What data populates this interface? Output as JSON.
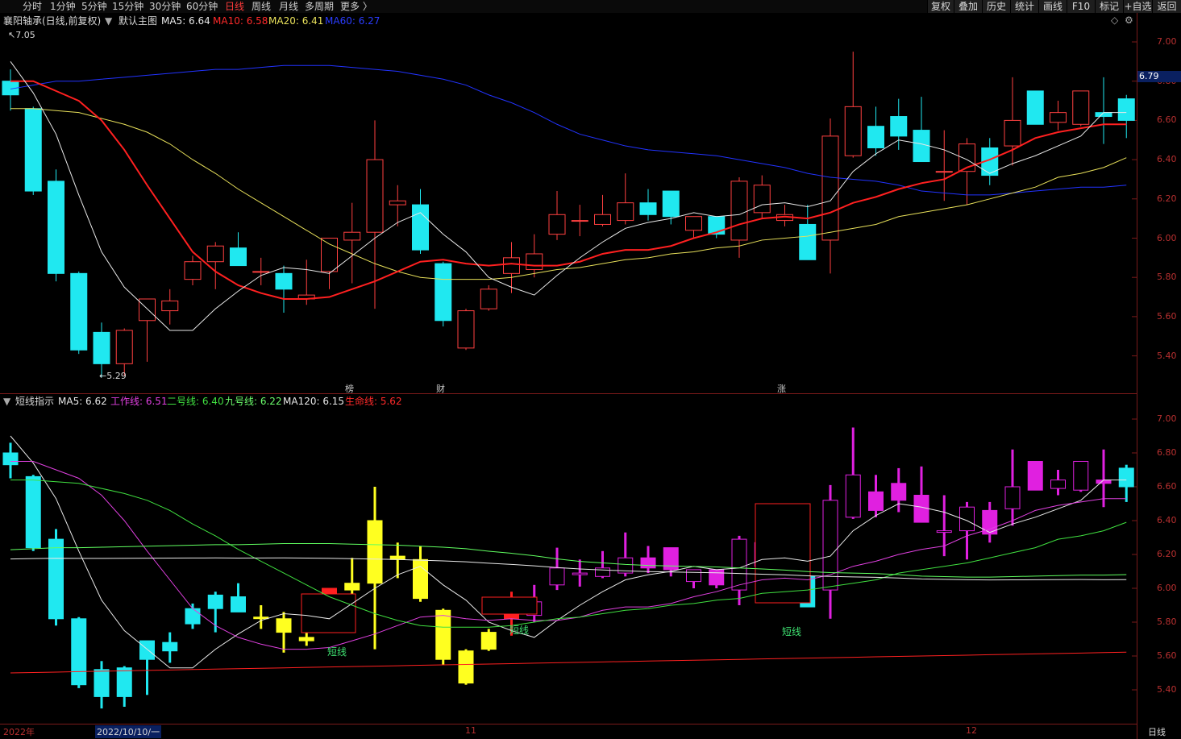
{
  "top_tabs": [
    {
      "label": "分时"
    },
    {
      "label": "1分钟"
    },
    {
      "label": "5分钟"
    },
    {
      "label": "15分钟"
    },
    {
      "label": "30分钟"
    },
    {
      "label": "60分钟"
    },
    {
      "label": "日线"
    },
    {
      "label": "周线"
    },
    {
      "label": "月线"
    },
    {
      "label": "多周期"
    },
    {
      "label": "更多 〉"
    }
  ],
  "active_tab": "日线",
  "right_tools": [
    {
      "label": "复权"
    },
    {
      "label": "叠加"
    },
    {
      "label": "历史"
    },
    {
      "label": "统计"
    },
    {
      "label": "画线"
    },
    {
      "label": "F10"
    },
    {
      "label": "标记"
    },
    {
      "label": "+自选"
    },
    {
      "label": "返回"
    }
  ],
  "main": {
    "title": "襄阳轴承(日线,前复权)",
    "template": "默认主图",
    "ma": [
      {
        "label": "MA5: 6.64",
        "color": "#e8e8e8"
      },
      {
        "label": "MA10: 6.58",
        "color": "#ff2a2a"
      },
      {
        "label": "MA20: 6.41",
        "color": "#e8e05a"
      },
      {
        "label": "MA60: 6.27",
        "color": "#2a3cff"
      }
    ],
    "y_ticks": [
      "7.00",
      "6.80",
      "6.60",
      "6.40",
      "6.20",
      "6.00",
      "5.80",
      "5.60",
      "5.40"
    ],
    "current_price": "6.79",
    "high_label": "7.05",
    "low_label": "5.29",
    "markers": [
      {
        "text": "榜",
        "color": "#ff9e40"
      },
      {
        "text": "财",
        "color": "#7ab8ff"
      },
      {
        "text": "涨",
        "color": "#ff6060"
      }
    ]
  },
  "sub": {
    "title": "短线指示",
    "lines": [
      {
        "label": "MA5: 6.62",
        "color": "#e8e8e8"
      },
      {
        "label": "工作线: 6.51",
        "color": "#e040e0"
      },
      {
        "label": "二号线: 6.40",
        "color": "#40e040"
      },
      {
        "label": "九号线: 6.22",
        "color": "#6cff6c"
      },
      {
        "label": "MA120: 6.15",
        "color": "#e8e8e8"
      },
      {
        "label": "生命线: 5.62",
        "color": "#ff2a2a"
      }
    ],
    "y_ticks": [
      "7.00",
      "6.80",
      "6.60",
      "6.40",
      "6.20",
      "6.00",
      "5.80",
      "5.60",
      "5.40"
    ],
    "signal_label": "短线"
  },
  "x_axis": {
    "labels": [
      "2022年",
      "2022/10/10/一",
      "11",
      "12"
    ],
    "period": "日线"
  },
  "chart_data": {
    "type": "candlestick",
    "ohlc": [
      [
        6.8,
        6.86,
        6.65,
        6.73
      ],
      [
        6.66,
        6.67,
        6.22,
        6.24
      ],
      [
        6.29,
        6.35,
        5.78,
        5.82
      ],
      [
        5.82,
        5.83,
        5.41,
        5.43
      ],
      [
        5.52,
        5.57,
        5.29,
        5.36
      ],
      [
        5.36,
        5.54,
        5.3,
        5.53
      ],
      [
        5.58,
        5.67,
        5.37,
        5.69
      ],
      [
        5.63,
        5.74,
        5.56,
        5.68
      ],
      [
        5.79,
        5.91,
        5.76,
        5.88
      ],
      [
        5.88,
        5.98,
        5.74,
        5.96
      ],
      [
        5.95,
        6.03,
        5.86,
        5.86
      ],
      [
        5.83,
        5.9,
        5.76,
        5.83
      ],
      [
        5.82,
        5.86,
        5.62,
        5.74
      ],
      [
        5.69,
        5.89,
        5.66,
        5.71
      ],
      [
        5.83,
        5.96,
        5.74,
        6.0
      ],
      [
        5.99,
        6.18,
        5.77,
        6.03
      ],
      [
        6.03,
        6.6,
        5.64,
        6.4
      ],
      [
        6.17,
        6.27,
        6.06,
        6.19
      ],
      [
        6.17,
        6.25,
        5.92,
        5.94
      ],
      [
        5.87,
        5.88,
        5.55,
        5.58
      ],
      [
        5.44,
        5.64,
        5.43,
        5.63
      ],
      [
        5.64,
        5.76,
        5.63,
        5.74
      ],
      [
        5.82,
        5.98,
        5.72,
        5.9
      ],
      [
        5.84,
        6.02,
        5.8,
        5.92
      ],
      [
        6.02,
        6.24,
        5.99,
        6.12
      ],
      [
        6.09,
        6.17,
        6.01,
        6.09
      ],
      [
        6.07,
        6.22,
        6.06,
        6.12
      ],
      [
        6.09,
        6.33,
        6.07,
        6.18
      ],
      [
        6.18,
        6.25,
        6.09,
        6.12
      ],
      [
        6.24,
        6.18,
        6.07,
        6.11
      ],
      [
        6.04,
        6.11,
        6.0,
        6.11
      ],
      [
        6.11,
        6.1,
        6.0,
        6.02
      ],
      [
        5.99,
        6.31,
        5.9,
        6.29
      ],
      [
        6.13,
        6.32,
        6.1,
        6.27
      ],
      [
        6.09,
        6.17,
        6.06,
        6.12
      ],
      [
        6.07,
        6.17,
        5.92,
        5.89
      ],
      [
        5.99,
        6.61,
        5.82,
        6.52
      ],
      [
        6.42,
        6.95,
        6.41,
        6.67
      ],
      [
        6.57,
        6.67,
        6.42,
        6.46
      ],
      [
        6.62,
        6.71,
        6.45,
        6.52
      ],
      [
        6.55,
        6.72,
        6.5,
        6.39
      ],
      [
        6.34,
        6.55,
        6.19,
        6.34
      ],
      [
        6.34,
        6.51,
        6.17,
        6.48
      ],
      [
        6.46,
        6.51,
        6.27,
        6.32
      ],
      [
        6.47,
        6.82,
        6.37,
        6.6
      ],
      [
        6.75,
        6.71,
        6.67,
        6.58
      ],
      [
        6.59,
        6.7,
        6.55,
        6.64
      ],
      [
        6.58,
        6.74,
        6.57,
        6.75
      ],
      [
        6.64,
        6.82,
        6.48,
        6.62
      ],
      [
        6.71,
        6.73,
        6.51,
        6.6
      ]
    ],
    "ma5": [
      6.9,
      6.74,
      6.53,
      6.22,
      5.93,
      5.75,
      5.64,
      5.53,
      5.53,
      5.64,
      5.73,
      5.81,
      5.85,
      5.84,
      5.82,
      5.91,
      6.0,
      6.08,
      6.13,
      6.02,
      5.93,
      5.8,
      5.75,
      5.71,
      5.81,
      5.9,
      5.98,
      6.05,
      6.08,
      6.1,
      6.13,
      6.11,
      6.12,
      6.17,
      6.18,
      6.16,
      6.19,
      6.34,
      6.43,
      6.5,
      6.48,
      6.45,
      6.4,
      6.33,
      6.38,
      6.42,
      6.47,
      6.52,
      6.64,
      6.64
    ],
    "ma10": [
      6.8,
      6.8,
      6.75,
      6.7,
      6.6,
      6.45,
      6.27,
      6.1,
      5.93,
      5.83,
      5.76,
      5.72,
      5.69,
      5.69,
      5.7,
      5.74,
      5.78,
      5.83,
      5.88,
      5.89,
      5.87,
      5.86,
      5.87,
      5.86,
      5.86,
      5.88,
      5.92,
      5.94,
      5.94,
      5.96,
      6.0,
      6.03,
      6.07,
      6.1,
      6.11,
      6.1,
      6.13,
      6.18,
      6.21,
      6.25,
      6.28,
      6.3,
      6.36,
      6.4,
      6.45,
      6.51,
      6.54,
      6.56,
      6.58,
      6.58
    ],
    "ma20": [
      6.66,
      6.66,
      6.65,
      6.64,
      6.61,
      6.58,
      6.54,
      6.48,
      6.4,
      6.33,
      6.25,
      6.18,
      6.11,
      6.04,
      5.97,
      5.92,
      5.87,
      5.83,
      5.8,
      5.79,
      5.79,
      5.79,
      5.8,
      5.82,
      5.84,
      5.85,
      5.87,
      5.89,
      5.9,
      5.92,
      5.93,
      5.95,
      5.96,
      5.99,
      6.0,
      6.01,
      6.03,
      6.05,
      6.07,
      6.11,
      6.13,
      6.15,
      6.17,
      6.2,
      6.23,
      6.26,
      6.31,
      6.33,
      6.36,
      6.41
    ],
    "ma60": [
      6.76,
      6.78,
      6.8,
      6.8,
      6.81,
      6.82,
      6.83,
      6.84,
      6.85,
      6.86,
      6.86,
      6.87,
      6.88,
      6.88,
      6.88,
      6.87,
      6.86,
      6.85,
      6.83,
      6.81,
      6.78,
      6.73,
      6.69,
      6.64,
      6.58,
      6.53,
      6.5,
      6.47,
      6.45,
      6.44,
      6.43,
      6.42,
      6.4,
      6.38,
      6.36,
      6.33,
      6.31,
      6.3,
      6.29,
      6.27,
      6.24,
      6.23,
      6.22,
      6.22,
      6.23,
      6.24,
      6.25,
      6.26,
      6.26,
      6.27
    ],
    "ylim": [
      5.3,
      7.1
    ]
  }
}
